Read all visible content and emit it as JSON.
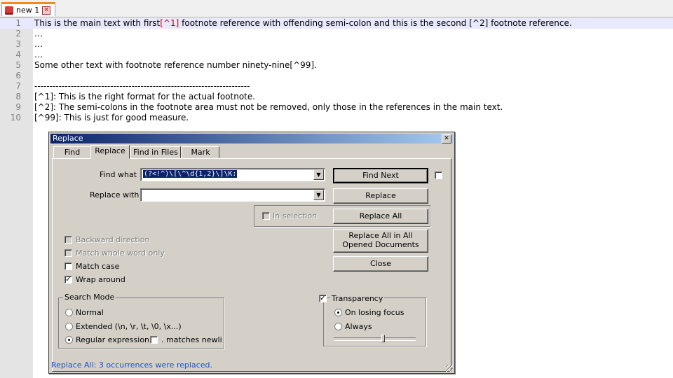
{
  "tabbar": {
    "tab_label": "new 1",
    "tab_icon": "saved-file-icon",
    "close_icon": "close-icon"
  },
  "editor": {
    "lines": [
      {
        "num": "1",
        "segments": [
          {
            "t": "This is the main text with first"
          },
          {
            "t": "[^1]",
            "ref": true
          },
          {
            "t": " footnote reference with offending semi-colon and this is the second [^2] footnote reference."
          }
        ],
        "current": true
      },
      {
        "num": "2",
        "segments": [
          {
            "t": "…"
          }
        ]
      },
      {
        "num": "3",
        "segments": [
          {
            "t": "…"
          }
        ]
      },
      {
        "num": "4",
        "segments": [
          {
            "t": "…"
          }
        ]
      },
      {
        "num": "5",
        "segments": [
          {
            "t": "Some other text with footnote reference number ninety-nine[^99]."
          }
        ]
      },
      {
        "num": "6",
        "segments": [
          {
            "t": ""
          }
        ]
      },
      {
        "num": "7",
        "segments": [
          {
            "t": "-----------------------------------------------------------------------"
          }
        ]
      },
      {
        "num": "8",
        "segments": [
          {
            "t": "[^1]: This is the right format for the actual footnote."
          }
        ]
      },
      {
        "num": "9",
        "segments": [
          {
            "t": "[^2]: The semi-colons in the footnote area must not be removed, only those in the references in the main text."
          }
        ]
      },
      {
        "num": "10",
        "segments": [
          {
            "t": "[^99]: This is just for good measure."
          }
        ]
      }
    ]
  },
  "dialog": {
    "title": "Replace",
    "close_label": "✕",
    "tabs": [
      "Find",
      "Replace",
      "Find in Files",
      "Mark"
    ],
    "active_tab": "Replace",
    "find_what_label": "Find what :",
    "find_what_value": "(?<!^)\\[\\^\\d{1,2}\\]\\K:",
    "replace_with_label": "Replace with :",
    "replace_with_value": "",
    "buttons": {
      "find_next": "Find Next",
      "replace": "Replace",
      "replace_all": "Replace All",
      "replace_all_docs_line1": "Replace All in All",
      "replace_all_docs_line2": "Opened Documents",
      "close": "Close"
    },
    "in_selection": {
      "label": "In selection",
      "checked": false,
      "enabled": false
    },
    "options": {
      "backward": {
        "label": "Backward direction",
        "checked": false,
        "enabled": false
      },
      "whole_word": {
        "label": "Match whole word only",
        "checked": false,
        "enabled": false
      },
      "match_case": {
        "label": "Match case",
        "checked": false,
        "enabled": true
      },
      "wrap_around": {
        "label": "Wrap around",
        "checked": true,
        "enabled": true
      }
    },
    "search_mode": {
      "title": "Search Mode",
      "normal": "Normal",
      "extended": "Extended (\\n, \\r, \\t, \\0, \\x...)",
      "regex": "Regular expression",
      "matches_newline": ". matches newlin",
      "selected": "regex"
    },
    "transparency": {
      "label": "Transparency",
      "checked": true,
      "on_losing_focus": "On losing focus",
      "always": "Always",
      "selected": "on_losing_focus",
      "slider_level": 0.6
    },
    "status": "Replace All: 3 occurrences were replaced."
  }
}
